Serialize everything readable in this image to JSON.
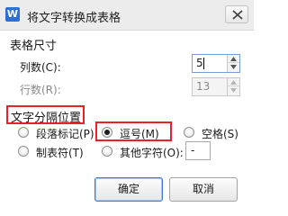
{
  "dialog": {
    "title": "将文字转换成表格",
    "app_icon": "W"
  },
  "table_size": {
    "heading": "表格尺寸",
    "columns_label": "列数(C):",
    "columns_value": "5",
    "rows_label": "行数(R):",
    "rows_value": "13"
  },
  "separator": {
    "heading": "文字分隔位置",
    "options": [
      {
        "label": "段落标记(P)",
        "checked": false
      },
      {
        "label": "逗号(M)",
        "checked": true
      },
      {
        "label": "空格(S)",
        "checked": false
      },
      {
        "label": "制表符(T)",
        "checked": false
      },
      {
        "label": "其他字符(O):",
        "checked": false
      }
    ],
    "other_char_value": "-"
  },
  "buttons": {
    "ok": "确定",
    "cancel": "取消"
  },
  "colors": {
    "highlight_border": "#e8212d",
    "focus_border": "#3a7bd5"
  },
  "icons": {
    "app": "wps-writer-icon",
    "close": "close-icon",
    "spin_up": "triangle-up-icon",
    "spin_down": "triangle-down-icon"
  }
}
